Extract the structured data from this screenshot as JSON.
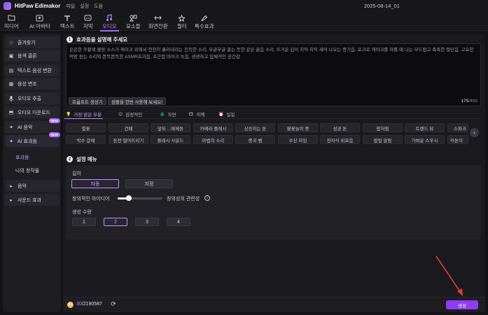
{
  "app": {
    "name": "HitPaw Edimakor",
    "menus": [
      "파일",
      "설정",
      "도움"
    ],
    "window_title": "2025-08-14_01"
  },
  "toolbar": [
    {
      "label": "미디어",
      "icon": "folder-icon"
    },
    {
      "label": "AI 아바타",
      "icon": "avatar-icon"
    },
    {
      "label": "텍스트",
      "icon": "text-icon"
    },
    {
      "label": "자막",
      "icon": "subtitle-icon"
    },
    {
      "label": "오디오",
      "icon": "music-note-icon",
      "active": true
    },
    {
      "label": "요소들",
      "icon": "elements-icon"
    },
    {
      "label": "화면전환",
      "icon": "transition-icon"
    },
    {
      "label": "필터",
      "icon": "filter-icon"
    },
    {
      "label": "특수효과",
      "icon": "effects-icon"
    }
  ],
  "sidebar": {
    "items": [
      {
        "label": "즐겨찾기",
        "icon": "star-icon"
      },
      {
        "label": "음색 클론",
        "icon": "voice-clone-icon"
      },
      {
        "label": "텍스트 음성 변환",
        "icon": "text-to-speech-icon"
      },
      {
        "label": "음성 변조",
        "icon": "voice-change-icon"
      },
      {
        "label": "오디오 추출",
        "icon": "microphone-icon"
      },
      {
        "label": "오디오 다운로드",
        "icon": "download-icon"
      },
      {
        "label": "AI 음악",
        "icon": "ai-music-icon",
        "badge": "NEW"
      },
      {
        "label": "AI 효과음",
        "icon": "ai-sfx-icon",
        "badge": "NEW",
        "selected": true
      }
    ],
    "subitems": [
      "효과음",
      "나의 창작물"
    ],
    "collapsed": [
      "음악",
      "사운드 효과"
    ]
  },
  "section1": {
    "number": "1",
    "title": "효과음을 설명해 주세요",
    "prompt": "은은한 주황색 불망 소스가 케이크 위에서 천천히 흘러내리는 진득한 소리, 부글부글 끓는 듯한 같은 끓음 소리, 뜨거운 김이 치익 치익 새어 나오는 증기음, 포크로 케이크를 자를 때 나는 부드럽고 촉촉한 절단음, 고요한 먹방 씬는 소리와 쫀득쫀득한 ASMR효과음, 초근접 마이크 녹음, 생생하고 입체적인 공간감",
    "prompt_generator_label": "프롬프트 생성기",
    "sample_label": "샘플을 한번 사용해 보세요!",
    "count_used": "175",
    "count_max": "/400"
  },
  "categories": [
    {
      "label": "가장 밝은 부분",
      "icon": "lightbulb-icon",
      "active": true
    },
    {
      "label": "감정적인",
      "icon": "emoji-icon"
    },
    {
      "label": "자연",
      "icon": "tree-icon"
    },
    {
      "label": "이펙",
      "icon": "film-icon"
    },
    {
      "label": "일일",
      "icon": "clock-icon"
    }
  ],
  "chips_row1": [
    "별꽃",
    "건배",
    "앞뒤 ...매제동",
    "카메라 플래시",
    "상승하는 톤",
    "불꽃놀이 쾅",
    "성공 톤",
    "팝처럼",
    "트렌드 뷰",
    "스파크"
  ],
  "chips_row2": [
    "박수 갈채",
    "동전 떨어뜨리기",
    "플래시 사운드",
    "마법의 소리",
    "중국 뱀",
    "수상 차임",
    "전자식 비프음",
    "팝업 알림",
    "가벼운 스우시",
    "카톤이"
  ],
  "section2": {
    "number": "2",
    "title": "설정 메뉴",
    "length_label": "길이",
    "length_options": [
      "자동",
      "지정"
    ],
    "creativity_left": "창의적인 아이디어",
    "creativity_right": "창의성의 관련성",
    "creativity_value": 0.25,
    "quantity_label": "생성 수량",
    "quantity_options": [
      "1",
      "2",
      "3",
      "4"
    ],
    "quantity_selected": "2"
  },
  "footer": {
    "credits_used": "30",
    "credits_total": "/2190587",
    "generate_label": "생성"
  },
  "colors": {
    "accent": "#9a6cff",
    "generate": "#8f3cf0",
    "arrow": "#e63b3b"
  }
}
